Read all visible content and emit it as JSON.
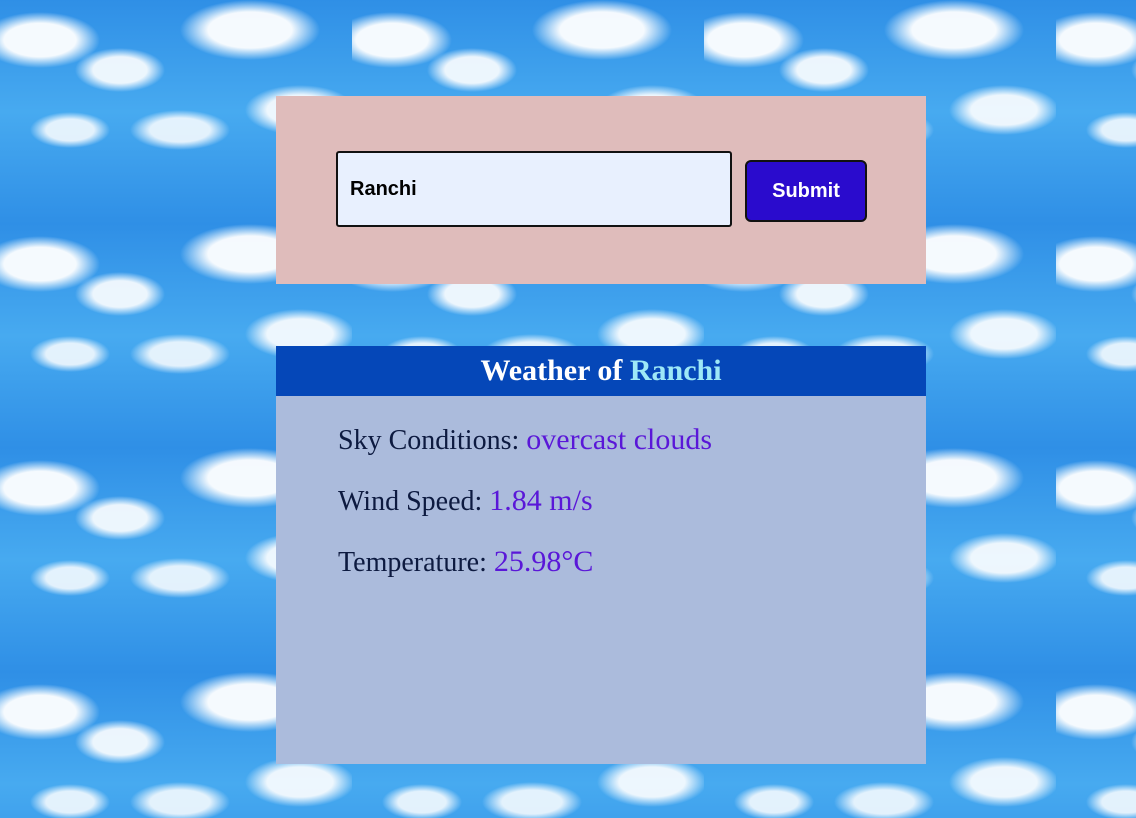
{
  "search": {
    "input_value": "Ranchi",
    "submit_label": "Submit"
  },
  "weather": {
    "title_prefix": "Weather of",
    "city": "Ranchi",
    "sky_label": "Sky Conditions:",
    "sky_value": "overcast clouds",
    "wind_label": "Wind Speed:",
    "wind_value": "1.84 m/s",
    "temp_label": "Temperature:",
    "temp_value": "25.98°C"
  },
  "colors": {
    "search_panel_bg": "#dfbcbb",
    "weather_panel_bg": "#abbbdc",
    "header_bg": "#0547b8",
    "header_city": "#9de8f7",
    "submit_bg": "#2a0bcd",
    "value_text": "#5a17d8"
  },
  "background": "sky-clouds-pattern"
}
